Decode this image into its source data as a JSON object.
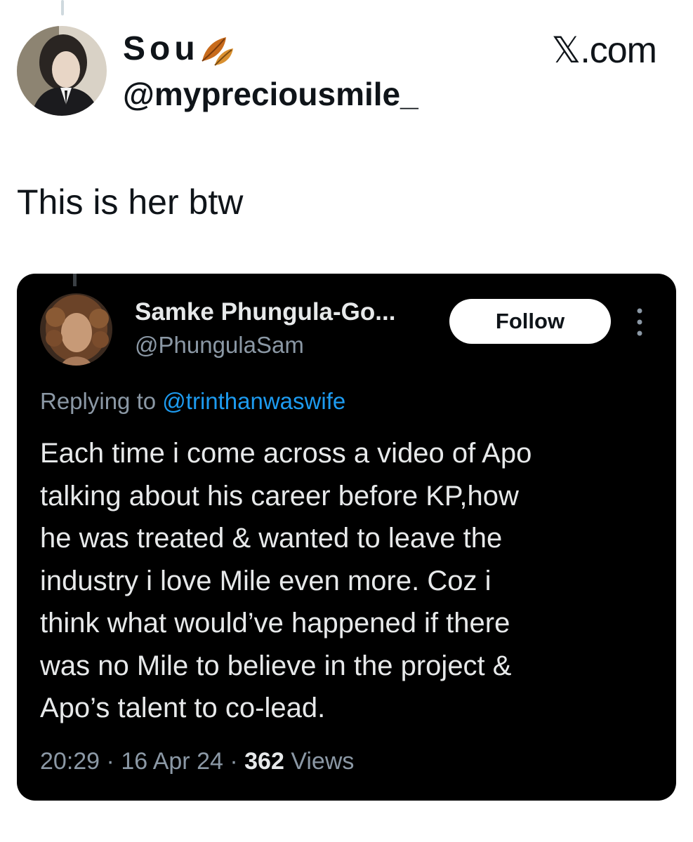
{
  "outer_tweet": {
    "display_name": "Sou",
    "name_emoji": "fallen-leaf-icon",
    "handle": "@mypreciousmile_",
    "source_label": "𝕏.com",
    "text": "This is her btw"
  },
  "quoted_tweet": {
    "display_name": "Samke Phungula-Go...",
    "handle": "@PhungulaSam",
    "follow_label": "Follow",
    "more_icon": "more-options-icon",
    "replying_prefix": "Replying to",
    "replying_to": "@trinthanwaswife",
    "body_lines": [
      "Each time i come across a video of Apo",
      "talking about his career before KP,how",
      "he was treated & wanted to leave the",
      "industry i love Mile even more. Coz i",
      "think what would’ve happened if there",
      "was no Mile to believe in the project &",
      "Apo’s talent to co-lead."
    ],
    "time": "20:29",
    "separator": "·",
    "date": "16 Apr 24",
    "views_count": "362",
    "views_label": "Views"
  },
  "colors": {
    "card_background": "#000000",
    "mention_blue": "#1d9bf0",
    "secondary_text": "#8b98a5",
    "card_text": "#e7e9ea"
  }
}
